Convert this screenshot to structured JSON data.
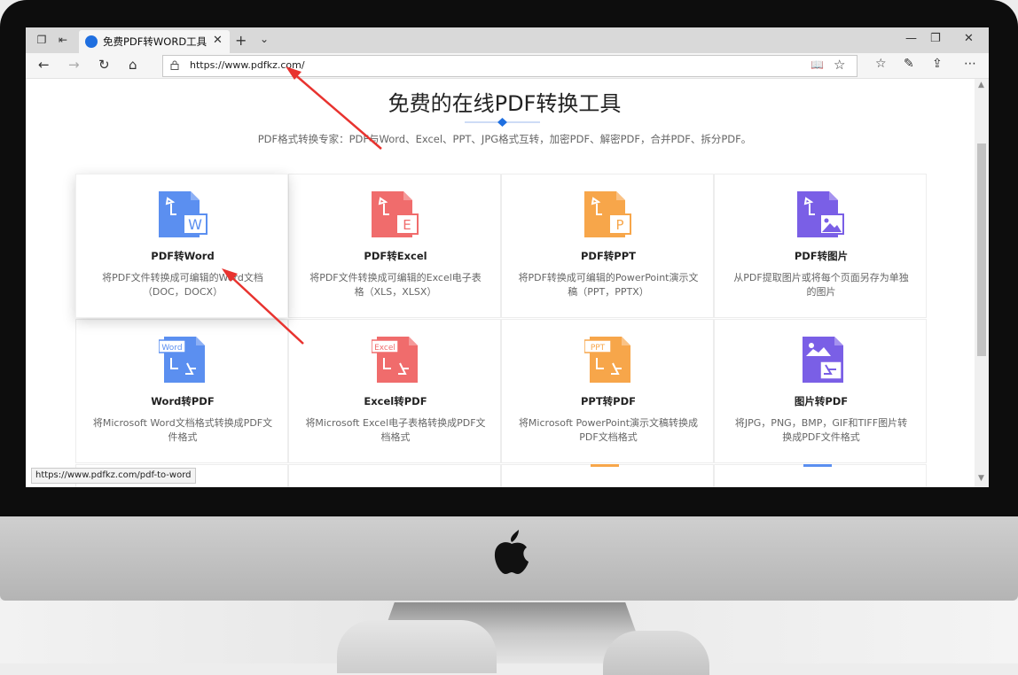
{
  "browser": {
    "tab_title": "免费PDF转WORD工具|P",
    "tab_close": "✕",
    "new_tab": "+",
    "tab_list": "⌄",
    "window_controls": [
      "—",
      "❐",
      "✕"
    ],
    "address_url": "https://www.pdfkz.com/",
    "status_url": "https://www.pdfkz.com/pdf-to-word"
  },
  "page": {
    "title": "免费的在线PDF转换工具",
    "subtitle": "PDF格式转换专家：PDF与Word、Excel、PPT、JPG格式互转，加密PDF、解密PDF，合并PDF、拆分PDF。",
    "accent_color": "#1f6fe0"
  },
  "tools": [
    {
      "name": "PDF转Word",
      "desc": "将PDF文件转换成可编辑的Word文档（DOC，DOCX）",
      "icon": "pdf-to-word-icon",
      "color": "#5b8ff0",
      "letter": "W"
    },
    {
      "name": "PDF转Excel",
      "desc": "将PDF文件转换成可编辑的Excel电子表格（XLS，XLSX）",
      "icon": "pdf-to-excel-icon",
      "color": "#f06c6c",
      "letter": "E"
    },
    {
      "name": "PDF转PPT",
      "desc": "将PDF转换成可编辑的PowerPoint演示文稿（PPT，PPTX）",
      "icon": "pdf-to-ppt-icon",
      "color": "#f7a64a",
      "letter": "P"
    },
    {
      "name": "PDF转图片",
      "desc": "从PDF提取图片或将每个页面另存为单独的图片",
      "icon": "pdf-to-image-icon",
      "color": "#7a5fe6",
      "letter": ""
    },
    {
      "name": "Word转PDF",
      "desc": "将Microsoft Word文档格式转换成PDF文件格式",
      "icon": "word-to-pdf-icon",
      "color": "#5b8ff0",
      "badge": "Word"
    },
    {
      "name": "Excel转PDF",
      "desc": "将Microsoft Excel电子表格转换成PDF文档格式",
      "icon": "excel-to-pdf-icon",
      "color": "#f06c6c",
      "badge": "Excel"
    },
    {
      "name": "PPT转PDF",
      "desc": "将Microsoft PowerPoint演示文稿转换成PDF文档格式",
      "icon": "ppt-to-pdf-icon",
      "color": "#f7a64a",
      "badge": "PPT"
    },
    {
      "name": "图片转PDF",
      "desc": "将JPG，PNG，BMP，GIF和TIFF图片转换成PDF文件格式",
      "icon": "image-to-pdf-icon",
      "color": "#7a5fe6",
      "badge": ""
    }
  ]
}
